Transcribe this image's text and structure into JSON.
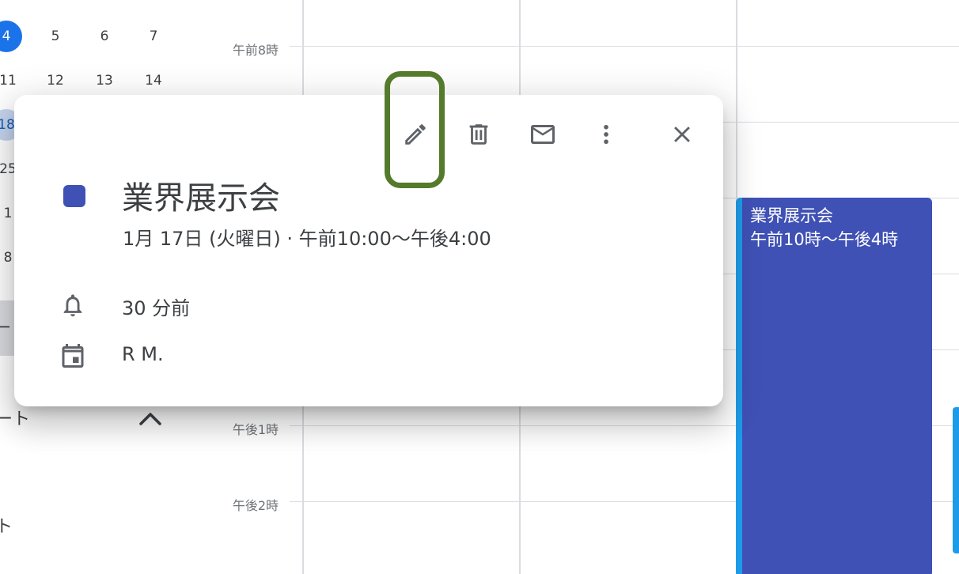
{
  "mini_calendar": {
    "row1": [
      "4",
      "5",
      "6",
      "7"
    ],
    "row2": [
      "11",
      "12",
      "13",
      "14"
    ],
    "row3": [
      "18"
    ],
    "row4": [
      "25"
    ],
    "row5": [
      "1"
    ],
    "row6": [
      "8"
    ],
    "side_text_1": "ート",
    "side_text_2": "ト",
    "side_text_3": "ー"
  },
  "grid": {
    "time_labels": [
      "午前8時",
      "午後1時",
      "午後2時"
    ]
  },
  "event_block": {
    "title": "業界展示会",
    "time": "午前10時〜午後4時"
  },
  "popup": {
    "title": "業界展示会",
    "date_time": "1月 17日 (火曜日)  ·  午前10:00〜午後4:00",
    "reminder": "30 分前",
    "calendar_owner": "R M.",
    "icons": {
      "edit": "pencil-icon",
      "delete": "trash-icon",
      "email": "mail-icon",
      "more": "more-vert-icon",
      "close": "close-icon",
      "reminder": "bell-icon",
      "calendar": "calendar-icon"
    }
  },
  "colors": {
    "event": "#3f51b5",
    "today": "#1a73e8",
    "highlight": "#547a2b"
  }
}
